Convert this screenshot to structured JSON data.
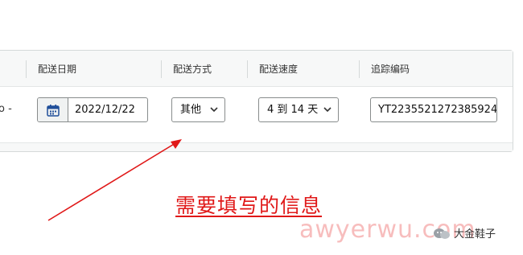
{
  "table": {
    "headers": {
      "ship_date": "配送日期",
      "ship_method": "配送方式",
      "ship_speed": "配送速度",
      "tracking": "追踪编码"
    },
    "row": {
      "prefix_text": "o -",
      "ship_date_value": "2022/12/22",
      "ship_method_value": "其他",
      "ship_speed_value": "4 到 14 天",
      "tracking_value": "YT2235521272385924"
    }
  },
  "annotation": {
    "text": "需要填写的信息",
    "color": "#e01818"
  },
  "watermark": {
    "site": "awyerwu.com",
    "brand": "大金鞋子"
  },
  "icons": {
    "calendar": "calendar-icon",
    "chevron": "chevron-down-icon",
    "brand_logo": "brand-logo-icon"
  },
  "colors": {
    "border": "#888c8c",
    "header_bg": "#f7f8f8",
    "accent_calendar": "#1f4e99"
  }
}
